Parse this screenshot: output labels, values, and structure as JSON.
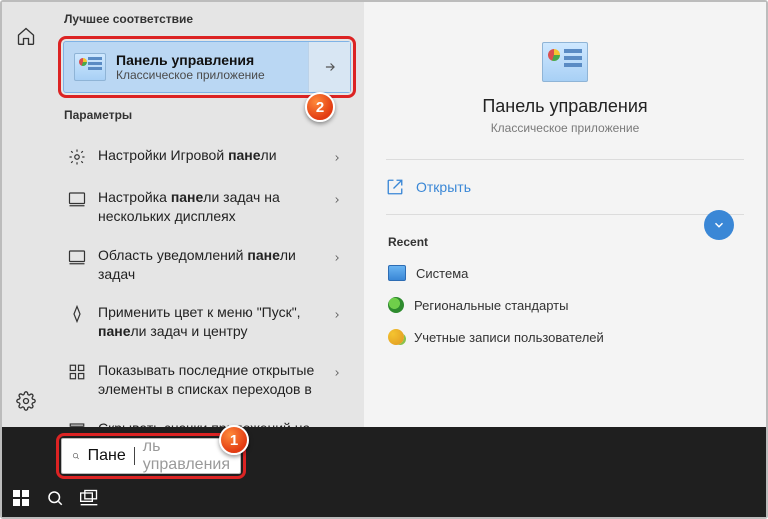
{
  "sections": {
    "best": "Лучшее соответствие",
    "params": "Параметры",
    "recent": "Recent"
  },
  "bestMatch": {
    "title": "Панель управления",
    "subtitle": "Классическое приложение"
  },
  "params": [
    "Настройки Игровой <b>пане</b>ли",
    "Настройка <b>пане</b>ли задач на нескольких дисплеях",
    "Область уведомлений <b>пане</b>ли задач",
    "Применить цвет к меню \"Пуск\", <b>пане</b>ли задач и центру",
    "Показывать последние открытые элементы в списках переходов в",
    "Скрывать значки приложений на <b>пане</b>ли задач в режиме планшета"
  ],
  "detail": {
    "title": "Панель управления",
    "subtitle": "Классическое приложение",
    "open": "Открыть"
  },
  "recent": [
    {
      "icon": "ri-sys",
      "label": "Система"
    },
    {
      "icon": "ri-reg",
      "label": "Региональные стандарты"
    },
    {
      "icon": "ri-usr",
      "label": "Учетные записи пользователей"
    }
  ],
  "search": {
    "prefix": "Пане",
    "suffix": "ль управления"
  },
  "callouts": {
    "one": "1",
    "two": "2"
  }
}
